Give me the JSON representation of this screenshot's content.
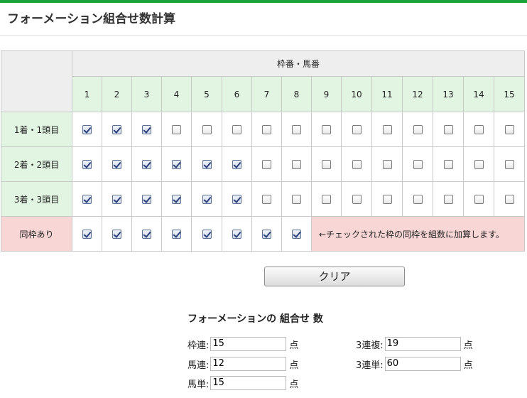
{
  "title": "フォーメーション組合せ数計算",
  "grid": {
    "group_header": "枠番・馬番",
    "numbers": [
      "1",
      "2",
      "3",
      "4",
      "5",
      "6",
      "7",
      "8",
      "9",
      "10",
      "11",
      "12",
      "13",
      "14",
      "15"
    ],
    "rows": [
      {
        "label": "1着・1頭目",
        "checked": [
          true,
          true,
          true,
          false,
          false,
          false,
          false,
          false,
          false,
          false,
          false,
          false,
          false,
          false,
          false
        ]
      },
      {
        "label": "2着・2頭目",
        "checked": [
          true,
          true,
          true,
          true,
          true,
          true,
          false,
          false,
          false,
          false,
          false,
          false,
          false,
          false,
          false
        ]
      },
      {
        "label": "3着・3頭目",
        "checked": [
          true,
          true,
          true,
          true,
          true,
          true,
          false,
          false,
          false,
          false,
          false,
          false,
          false,
          false,
          false
        ]
      }
    ],
    "same_frame": {
      "label": "同枠あり",
      "checked": [
        true,
        true,
        true,
        true,
        true,
        true,
        true,
        true
      ],
      "note": "←チェックされた枠の同枠を組数に加算します。"
    }
  },
  "clear_button": "クリア",
  "results": {
    "title": "フォーメーションの 組合せ 数",
    "unit": "点",
    "waku_ren": {
      "label": "枠連:",
      "value": "15"
    },
    "uma_ren": {
      "label": "馬連:",
      "value": "12"
    },
    "uma_tan": {
      "label": "馬単:",
      "value": "15"
    },
    "sanrenpuku": {
      "label": "3連複:",
      "value": "19"
    },
    "sanrentan": {
      "label": "3連単:",
      "value": "60"
    }
  },
  "colors": {
    "top_bar": "#1aa33a",
    "header_green": "#e2f4e2",
    "header_gray": "#eeeeee",
    "pink": "#f9d6d6"
  }
}
